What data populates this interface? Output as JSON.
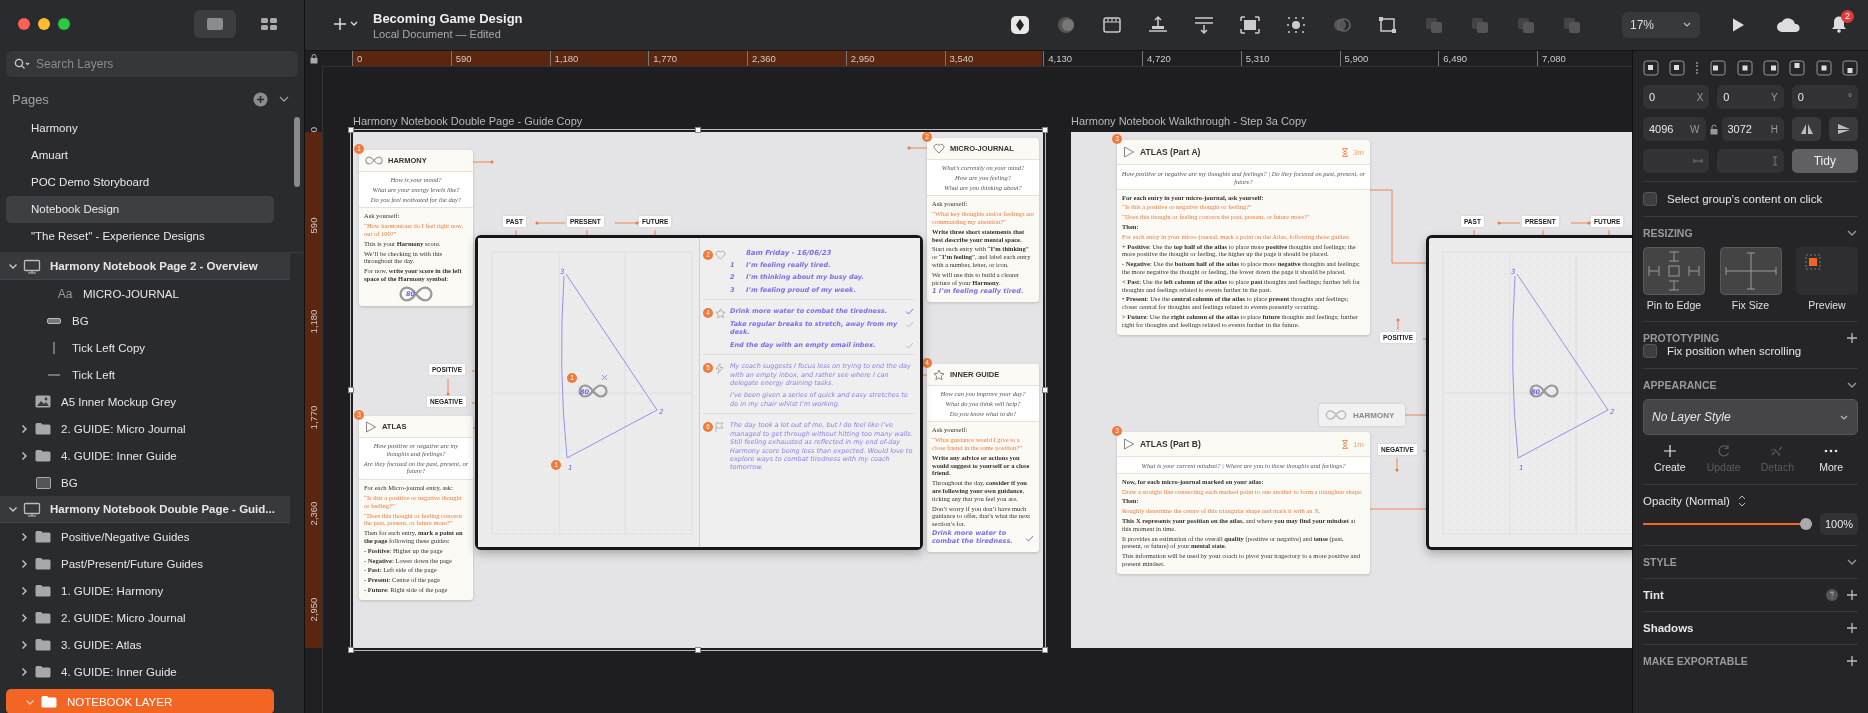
{
  "sidebar": {
    "search": {
      "placeholder": "Search Layers"
    },
    "pages_heading": "Pages",
    "pages": [
      {
        "label": "Harmony",
        "selected": false
      },
      {
        "label": "Amuart",
        "selected": false
      },
      {
        "label": "POC Demo Storyboard",
        "selected": false
      },
      {
        "label": "Notebook Design",
        "selected": true
      },
      {
        "label": "\"The Reset\" - Experience Designs",
        "selected": false
      }
    ],
    "layers": [
      {
        "label": "Harmony Notebook Page 2 - Overview",
        "kind": "artboard",
        "expanded": true,
        "selected": false,
        "children": [
          {
            "children": [
              {
                "children": [
                  {
                    "label": "MICRO-JOURNAL",
                    "kind": "text",
                    "glyph": "Aa",
                    "selected": false
                  }
                ]
              },
              {
                "label": "BG",
                "kind": "rect",
                "selected": false
              },
              {
                "label": "Tick Left Copy",
                "kind": "vline",
                "selected": false
              },
              {
                "label": "Tick Left",
                "kind": "hline",
                "selected": false
              }
            ]
          },
          {
            "label": "A5 Inner Mockup Grey",
            "kind": "image",
            "selected": false
          },
          {
            "label": "2. GUIDE: Micro Journal",
            "kind": "folder",
            "expanded": false,
            "selected": false
          },
          {
            "label": "4. GUIDE: Inner Guide",
            "kind": "folder",
            "expanded": false,
            "selected": false
          },
          {
            "label": "BG",
            "kind": "shape",
            "selected": false
          }
        ]
      },
      {
        "label": "Harmony Notebook Double Page - Guid...",
        "kind": "artboard",
        "expanded": true,
        "selected": false,
        "children": [
          {
            "label": "Positive/Negative Guides",
            "kind": "folder",
            "expanded": false,
            "selected": false
          },
          {
            "label": "Past/Present/Future Guides",
            "kind": "folder",
            "expanded": false,
            "selected": false
          },
          {
            "label": "1. GUIDE: Harmony",
            "kind": "folder",
            "expanded": false,
            "selected": false
          },
          {
            "label": "2. GUIDE: Micro Journal",
            "kind": "folder",
            "expanded": false,
            "selected": false
          },
          {
            "label": "3. GUIDE: Atlas",
            "kind": "folder",
            "expanded": false,
            "selected": false
          },
          {
            "label": "4. GUIDE: Inner Guide",
            "kind": "folder",
            "expanded": false,
            "selected": false
          },
          {
            "label": "NOTEBOOK LAYER",
            "kind": "folder",
            "expanded": true,
            "selected": true
          }
        ]
      }
    ]
  },
  "toolbar": {
    "title": "Becoming Game Design",
    "subtitle": "Local Document — Edited",
    "zoom": "17%",
    "notification_count": "2"
  },
  "rulers": {
    "horizontal": [
      "0",
      "590",
      "1,180",
      "1,770",
      "2,360",
      "2,950",
      "3,540",
      "4,130",
      "4,720",
      "5,310",
      "5,900",
      "6,490",
      "7,080"
    ],
    "vertical": [
      "0",
      "590",
      "1,180",
      "1,770",
      "2,360",
      "2,950"
    ]
  },
  "canvas": {
    "artboards": [
      {
        "title": "Harmony Notebook Double Page - Guide Copy",
        "selected": true,
        "cards": [
          {
            "badge": "1",
            "heading": "HARMONY",
            "questions": [
              "How is your mood?",
              "What are your energy levels like?",
              "Do you feel motivated for the day?"
            ],
            "body": [
              {
                "kind": "plain",
                "text": "Ask yourself:"
              },
              {
                "kind": "accent",
                "text": "“How harmonious do I feel right now, out of 100?”"
              },
              {
                "kind": "plain",
                "text": "This is your **Harmony** score."
              },
              {
                "kind": "plain",
                "text": "We’ll be checking in with this throughout the day."
              },
              {
                "kind": "plain",
                "text": "For now, **write your score in the left space of the Harmony symbol**:"
              }
            ],
            "score": "80"
          },
          {
            "badge": "3",
            "heading": "ATLAS",
            "questions": [
              "How positive or negative are my thoughts and feelings?",
              "Are they focused on the past, present, or future?"
            ],
            "body": [
              {
                "kind": "plain",
                "text": "For each Micro-journal entry, ask:"
              },
              {
                "kind": "accent",
                "text": "“Is this a positive or negative thought or feeling?”"
              },
              {
                "kind": "accent",
                "text": "“Does this thought or feeling concern the past, present, or future more?”"
              },
              {
                "kind": "plain",
                "text": "Then for each entry, **mark a point on the page** following these guides:"
              },
              {
                "kind": "list",
                "text": "- **Positive**: Higher up the page"
              },
              {
                "kind": "list",
                "text": "- **Negative**: Lower down the page"
              },
              {
                "kind": "list",
                "text": "- **Past**: Left side of the page"
              },
              {
                "kind": "list",
                "text": "- **Present**: Centre of the page"
              },
              {
                "kind": "list",
                "text": "- **Future**: Right side of the page"
              }
            ]
          },
          {
            "badge": "2",
            "heading": "MICRO-JOURNAL",
            "questions": [
              "What’s currently on your mind?",
              "How are you feeling?",
              "What are you thinking about?"
            ],
            "body": [
              {
                "kind": "plain",
                "text": "Ask yourself:"
              },
              {
                "kind": "accent",
                "text": "“What key thoughts and/or feelings are commanding my attention?”"
              },
              {
                "kind": "bold",
                "text": "Write three short statements that best describe your mental space."
              },
              {
                "kind": "plain",
                "text": "Start each entry with “**I’m thinking**” or “**I’m feeling**”, and label each entry with a number, letter, or icon."
              },
              {
                "kind": "plain",
                "text": "We will use this to build a clearer picture of your **Harmony**."
              },
              {
                "kind": "hand",
                "text": "1   I’m feeling really tired."
              }
            ]
          },
          {
            "badge": "4",
            "heading": "INNER GUIDE",
            "questions": [
              "How can you improve your day?",
              "What do you think will help?",
              "Do you know what to do?"
            ],
            "body": [
              {
                "kind": "plain",
                "text": "Ask yourself:"
              },
              {
                "kind": "accent",
                "text": "“What guidance would I give to a close friend in the same position?”"
              },
              {
                "kind": "bold",
                "text": "Write any advice or actions you would suggest to yourself or a close friend."
              },
              {
                "kind": "plain",
                "text": "Throughout the day, **consider if you are following your own guidance**, ticking any that you feel you are."
              },
              {
                "kind": "plain",
                "text": "Don’t worry if you don’t have much guidance to offer, that’s what the next section’s for."
              },
              {
                "kind": "hand",
                "text": "Drink more water to combat the tiredness.",
                "checked": true
              }
            ]
          }
        ],
        "tags": [
          "PAST",
          "PRESENT",
          "FUTURE",
          "POSITIVE",
          "NEGATIVE"
        ],
        "notebook": {
          "atlas": {
            "vertices": [
              "3",
              "2",
              "1"
            ],
            "score": "80",
            "cross": true,
            "badges": [
              "1",
              "1"
            ]
          },
          "journal": [
            {
              "badge": "2",
              "title": "8am Friday - 16/06/23",
              "items": [
                {
                  "num": "1",
                  "text": "I’m feeling really tired."
                },
                {
                  "num": "2",
                  "text": "I’m thinking about my busy day."
                },
                {
                  "num": "3",
                  "text": "I’m feeling proud of my week."
                }
              ]
            },
            {
              "badge": "4",
              "items": [
                {
                  "text": "Drink more water to combat the tiredness.",
                  "checked": true
                },
                {
                  "text": "Take regular breaks to stretch, away from my desk.",
                  "checked": false
                },
                {
                  "text": "End the day with an empty email inbox.",
                  "checked": false
                }
              ]
            },
            {
              "badge": "5",
              "items": [
                {
                  "text": "My coach suggests I focus less on trying to end the day with an empty inbox, and rather see where I can delegate energy draining tasks."
                },
                {
                  "text": "I’ve been given a series of quick and easy stretches to do in my chair whilst I’m working."
                }
              ]
            },
            {
              "badge": "6",
              "items": [
                {
                  "text": "The day took a lot out of me, but I do feel like I’ve managed to get through without hitting too many walls. Still feeling exhausted as reflected in my end of-day Harmony score being less than expected. Would love to explore ways to combat tiredness with my coach tomorrow."
                }
              ]
            }
          ]
        }
      },
      {
        "title": "Harmony Notebook Walkthrough - Step 3a Copy",
        "selected": false,
        "cards": [
          {
            "badge": "3",
            "heading": "ATLAS (Part A)",
            "time": "3m",
            "questions": [
              "How positive or negative are my thoughts and feelings?  |  Do they focused on past, present, or future?"
            ],
            "body": [
              {
                "kind": "bold",
                "text": "For each entry in your micro-journal, ask yourself:"
              },
              {
                "kind": "accent",
                "text": "“Is this a positive or negative thought or feeling?”"
              },
              {
                "kind": "accent",
                "text": "“Does this thought or feeling concern the past, present, or future more?”"
              },
              {
                "kind": "bold",
                "text": "Then:"
              },
              {
                "kind": "accent",
                "text": "For each entry in your micro-journal, mark a point on the Atlas, following these guides:"
              },
              {
                "kind": "plain",
                "text": "+ **Positive**: Use the **top half of the atlas** to place more **positive** thoughts and feelings; the more positive the thought or feeling, the higher up the page it should be placed."
              },
              {
                "kind": "plain",
                "text": "- **Negative**: Use the **bottom half of the atlas** to place more **negative** thoughts and feelings; the more negative the thought or feeling, the lower down the page it should be placed."
              },
              {
                "kind": "plain",
                "text": "< **Past**: Use the **left column of the atlas** to place **past** thoughts and feelings; further left for thoughts and feelings related to events further in the past."
              },
              {
                "kind": "plain",
                "text": "• **Present**: Use the **central column of the atlas** to place **present** thoughts and feelings; closer central for thoughts and feelings related to events presently occuring."
              },
              {
                "kind": "plain",
                "text": "> **Future**: Use the **right column of the atlas** to place **future** thoughts and feelings; further right for thoughts and feelings related to events further in the future."
              }
            ]
          },
          {
            "badge": "3",
            "heading": "ATLAS (Part B)",
            "time": "1m",
            "questions": [
              "What is your current mindset?  |  Where are you in these thoughts and feelings?"
            ],
            "body": [
              {
                "kind": "bold",
                "text": "Now, for each micro-journal marked on your atlas:"
              },
              {
                "kind": "accent",
                "text": "Draw a straight line connecting each marked point to one another to form a triangluar shape."
              },
              {
                "kind": "bold",
                "text": "Then:"
              },
              {
                "kind": "accent",
                "text": "Roughly determine the centre of this triangular shape and mark it with an X."
              },
              {
                "kind": "plain",
                "text": "**This X represents your position on the atlas**, and where **you may find your mindset** at this moment in time."
              },
              {
                "kind": "plain",
                "text": "It provides an estimation of the overall **quality** (positive or negative) and **tense** (past, present, or future) of your **mental state**."
              },
              {
                "kind": "plain",
                "text": "This information will be used by your coach to pivot your tragectory to a more positive and present mindset."
              }
            ]
          }
        ],
        "tags": [
          "PAST",
          "PRESENT",
          "FUTURE",
          "POSITIVE",
          "NEGATIVE"
        ],
        "pill": "HARMONY",
        "notebook": {
          "atlas": {
            "vertices": [
              "3",
              "2",
              "1"
            ],
            "score": "80"
          }
        }
      }
    ]
  },
  "inspector": {
    "position": [
      {
        "value": "0",
        "unit": "X"
      },
      {
        "value": "0",
        "unit": "Y"
      },
      {
        "value": "0",
        "unit": "°"
      }
    ],
    "size": [
      {
        "value": "4096",
        "unit": "W"
      },
      {
        "value": "3072",
        "unit": "H"
      }
    ],
    "tidy": "Tidy",
    "select_group_content": {
      "label": "Select group’s content on click",
      "checked": false
    },
    "resizing": {
      "heading": "RESIZING",
      "options": [
        "Pin to Edge",
        "Fix Size",
        "Preview"
      ]
    },
    "prototyping": {
      "heading": "PROTOTYPING",
      "fix_position": {
        "label": "Fix position when scrolling",
        "checked": false
      }
    },
    "appearance": {
      "heading": "APPEARANCE",
      "layer_style": "No Layer Style",
      "actions": [
        {
          "label": "Create",
          "disabled": false
        },
        {
          "label": "Update",
          "disabled": true
        },
        {
          "label": "Detach",
          "disabled": true
        },
        {
          "label": "More",
          "disabled": false
        }
      ],
      "opacity_label": "Opacity (Normal)",
      "opacity": {
        "level": 1
      },
      "opacity_value": "100%"
    },
    "style_heading": "STYLE",
    "tint_label": "Tint",
    "shadows_label": "Shadows",
    "export_heading": "MAKE EXPORTABLE"
  }
}
